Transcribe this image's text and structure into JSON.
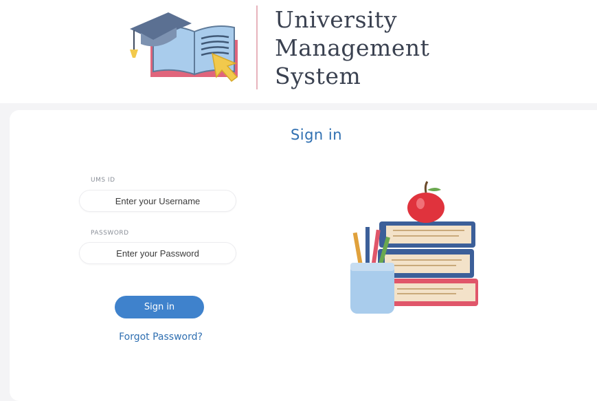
{
  "branding": {
    "title_lines": [
      "University",
      "Management",
      "System"
    ],
    "logo_icon": "graduation-cap-book-cursor-icon"
  },
  "login": {
    "title": "Sign in",
    "username_label": "UMS ID",
    "username_placeholder": "Enter your Username",
    "password_label": "PASSWORD",
    "password_placeholder": "Enter your Password",
    "submit_label": "Sign in",
    "forgot_label": "Forgot Password?"
  },
  "illustration": {
    "icon": "books-apple-pencil-cup-illustration"
  },
  "colors": {
    "accent": "#3f82cc",
    "title": "#2f6fb1",
    "background": "#f4f4f6"
  }
}
